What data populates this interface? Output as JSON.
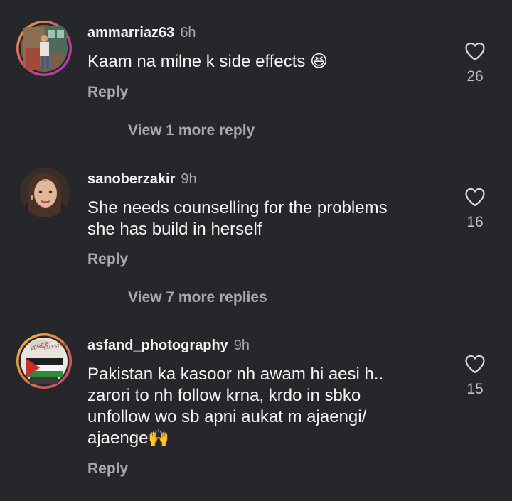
{
  "comments": [
    {
      "username": "ammarriaz63",
      "time": "6h",
      "text": "Kaam na milne k side effects 😆",
      "reply_label": "Reply",
      "view_more": "View 1 more reply",
      "likes": "26",
      "avatar_ring": "#c8589a",
      "like_icon": "heart-outline-icon"
    },
    {
      "username": "sanoberzakir",
      "time": "9h",
      "text": "She needs counselling for the problems\nshe has build in herself",
      "reply_label": "Reply",
      "view_more": "View 7 more replies",
      "likes": "16",
      "like_icon": "heart-outline-icon"
    },
    {
      "username": "asfand_photography",
      "time": "9h",
      "text": "Pakistan ka kasoor nh awam hi aesi h..\nzarori to nh follow krna, krdo in sbko\nunfollow wo sb apni aukat m ajaengi/\najaenge🙌",
      "reply_label": "Reply",
      "likes": "15",
      "avatar_ring": "#e0a040",
      "like_icon": "heart-outline-icon"
    }
  ],
  "theme": {
    "background": "#26272b",
    "text": "#f5f5f5",
    "muted": "#a8a8ad"
  }
}
